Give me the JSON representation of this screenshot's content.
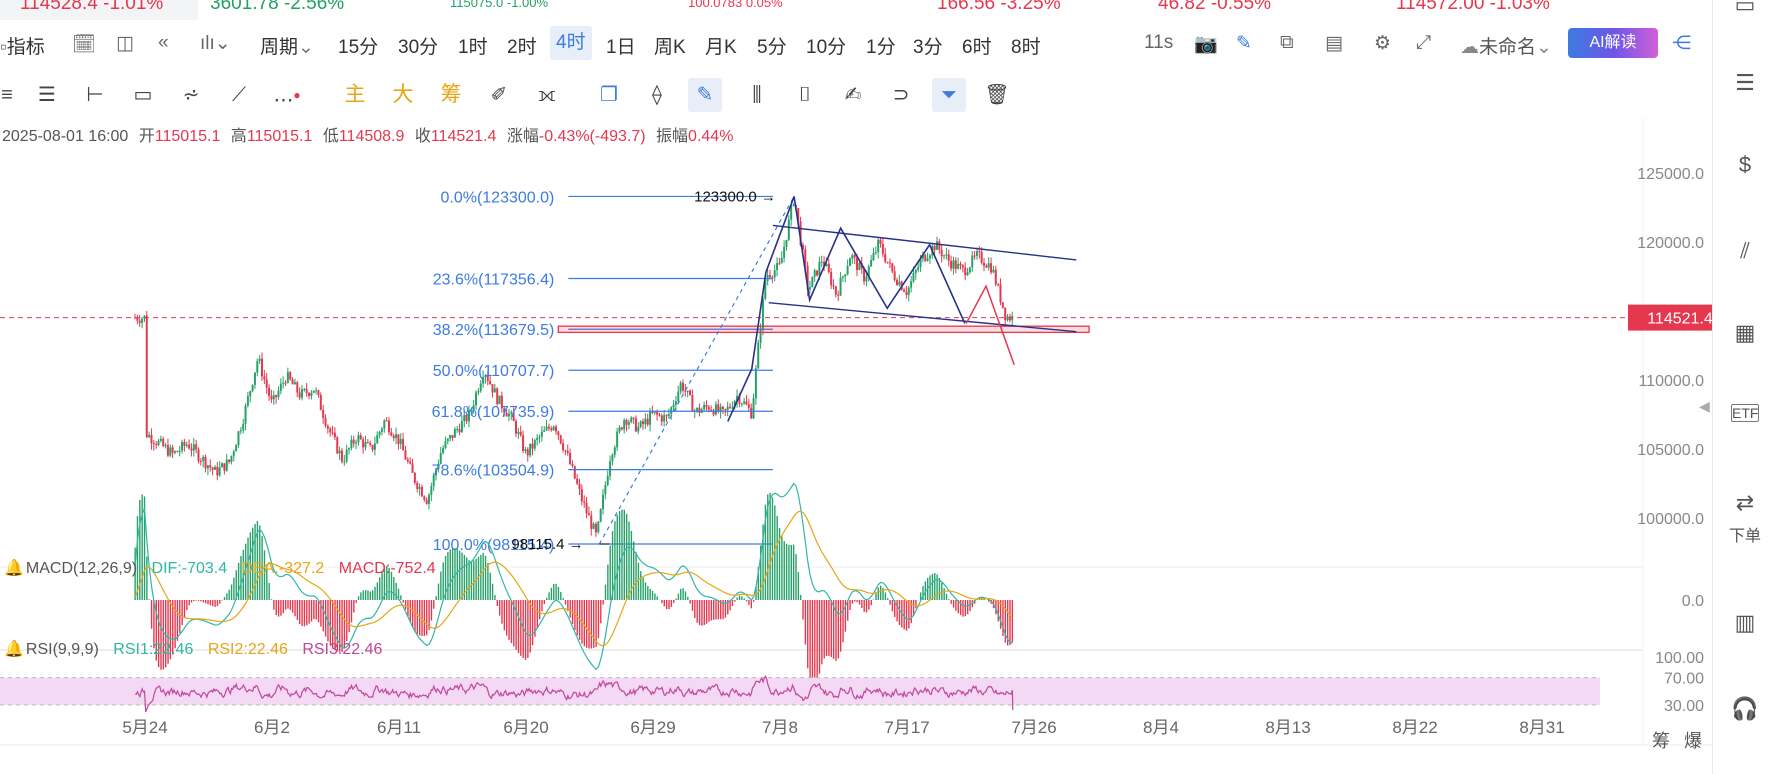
{
  "ticker": [
    {
      "text": "114528.4 -1.01%",
      "color": "red"
    },
    {
      "text": "3601.78 -2.56%",
      "color": "green"
    },
    {
      "text": "115075.0 -1.00%",
      "color": "green",
      "small": true
    },
    {
      "text": "100.0783 0.05%",
      "color": "red",
      "small": true
    },
    {
      "text": "166.56 -3.25%",
      "color": "red"
    },
    {
      "text": "46.82 -0.55%",
      "color": "red"
    },
    {
      "text": "114572.00 -1.03%",
      "color": "red"
    }
  ],
  "toolbar": {
    "indicator_label": "指标",
    "period_label": "周期",
    "periods": [
      "15分",
      "30分",
      "1时",
      "2时",
      "4时",
      "1日",
      "周K",
      "月K",
      "5分",
      "10分",
      "1分",
      "3分",
      "6时",
      "8时"
    ],
    "active_period": "4时",
    "timer": "11s",
    "layout_name": "未命名",
    "ai_label": "AI解读"
  },
  "drawing_tools": {
    "main_label": "主",
    "big_label": "大",
    "chip_label": "筹"
  },
  "info": {
    "datetime": "2025-08-01 16:00",
    "open_label": "开",
    "open": "115015.1",
    "high_label": "高",
    "high": "115015.1",
    "low_label": "低",
    "low": "114508.9",
    "close_label": "收",
    "close": "114521.4",
    "change_label": "涨幅",
    "change": "-0.43%(-493.7)",
    "amp_label": "振幅",
    "amp": "0.44%"
  },
  "chart_data": {
    "type": "candlestick",
    "symbol_interval": "4时",
    "y_ticks": [
      "125000.0",
      "120000.0",
      "110000.0",
      "105000.0",
      "100000.0"
    ],
    "ylim": [
      96500,
      126500
    ],
    "x_ticks": [
      "5月24",
      "6月2",
      "6月11",
      "6月20",
      "6月29",
      "7月8",
      "7月17",
      "7月26",
      "8月4",
      "8月13",
      "8月22",
      "8月31"
    ],
    "current_price": "114521.4",
    "price_path": [
      [
        0,
        106200
      ],
      [
        2,
        104600
      ],
      [
        3,
        105400
      ],
      [
        5,
        103300
      ],
      [
        6,
        104100
      ],
      [
        7,
        107400
      ],
      [
        8,
        111600
      ],
      [
        9,
        108200
      ],
      [
        10,
        110300
      ],
      [
        11,
        108900
      ],
      [
        12,
        109400
      ],
      [
        13,
        106500
      ],
      [
        14,
        104200
      ],
      [
        15,
        105900
      ],
      [
        16,
        104900
      ],
      [
        17,
        107100
      ],
      [
        18,
        105600
      ],
      [
        19,
        103000
      ],
      [
        20,
        101300
      ],
      [
        21,
        104900
      ],
      [
        22,
        106300
      ],
      [
        23,
        107500
      ],
      [
        24,
        110800
      ],
      [
        25,
        108600
      ],
      [
        26,
        107200
      ],
      [
        27,
        104600
      ],
      [
        28,
        105900
      ],
      [
        29,
        106900
      ],
      [
        30,
        104300
      ],
      [
        31,
        101200
      ],
      [
        32,
        98600
      ],
      [
        33,
        104700
      ],
      [
        34,
        107300
      ],
      [
        35,
        106500
      ],
      [
        36,
        107500
      ],
      [
        37,
        107200
      ],
      [
        38,
        109800
      ],
      [
        39,
        107700
      ],
      [
        40,
        108100
      ],
      [
        41,
        107500
      ],
      [
        42,
        108900
      ],
      [
        43,
        107600
      ],
      [
        43.5,
        112800
      ],
      [
        44,
        117600
      ],
      [
        45,
        118200
      ],
      [
        46,
        123300
      ],
      [
        47,
        116500
      ],
      [
        48,
        118800
      ],
      [
        49,
        116200
      ],
      [
        50,
        119100
      ],
      [
        51,
        117400
      ],
      [
        52,
        119900
      ],
      [
        53,
        117700
      ],
      [
        54,
        116400
      ],
      [
        55,
        118700
      ],
      [
        56,
        119800
      ],
      [
        57,
        118600
      ],
      [
        58,
        117900
      ],
      [
        59,
        119000
      ],
      [
        60,
        118200
      ],
      [
        61,
        114600
      ],
      [
        61.5,
        114521
      ]
    ],
    "fibonacci": [
      {
        "label": "0.0%(123300.0)",
        "value": 123300.0
      },
      {
        "label": "23.6%(117356.4)",
        "value": 117356.4
      },
      {
        "label": "38.2%(113679.5)",
        "value": 113679.5
      },
      {
        "label": "50.0%(110707.7)",
        "value": 110707.7
      },
      {
        "label": "61.8%(107735.9)",
        "value": 107735.9
      },
      {
        "label": "78.6%(103504.9)",
        "value": 103504.9
      },
      {
        "label": "100.0%(98115.4)",
        "value": 98115.4
      }
    ],
    "annotations": [
      {
        "text": "123300.0",
        "value": 123300.0
      },
      {
        "text": "98115.4",
        "value": 98115.4
      }
    ],
    "macd": {
      "label": "MACD(12,26,9)",
      "dif_label": "DIF:",
      "dif": "-703.4",
      "dea_label": "DEA:",
      "dea": "-327.2",
      "macd_label": "MACD:",
      "macd": "-752.4",
      "zero_tick": "0.0",
      "colors": {
        "dif": "#2fb7a8",
        "dea": "#e8a516",
        "hist_up": "#26a269",
        "hist_down": "#e5384f"
      }
    },
    "rsi": {
      "label": "RSI(9,9,9)",
      "rsi1_label": "RSI1:",
      "rsi1": "22.46",
      "rsi2_label": "RSI2:",
      "rsi2": "22.46",
      "rsi3_label": "RSI3:",
      "rsi3": "22.46",
      "ticks": [
        "100.00",
        "70.00",
        "30.00"
      ],
      "colors": {
        "line": "#c2459e",
        "band": "#f3d9f3"
      }
    },
    "colors": {
      "up": "#26a269",
      "down": "#e5384f",
      "fib": "#3d7be0",
      "trend": "#27318a",
      "price_line": "#e5384f"
    }
  },
  "bottom_right": {
    "chip": "筹",
    "burst": "爆"
  },
  "sidebar": {
    "order_label": "下单"
  }
}
